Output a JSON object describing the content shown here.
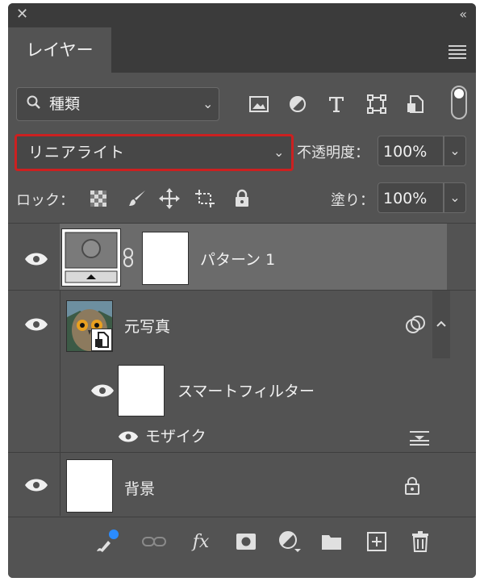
{
  "window": {
    "close_glyph": "✕",
    "collapse_glyph": "‹‹"
  },
  "tab": {
    "label": "レイヤー"
  },
  "filter": {
    "kind_label": "種類",
    "icons": [
      "image-filter-icon",
      "adjustment-filter-icon",
      "type-filter-icon",
      "shape-filter-icon",
      "smart-object-filter-icon"
    ]
  },
  "blend": {
    "mode": "リニアライト"
  },
  "opacity": {
    "label": "不透明度：",
    "value": "100%"
  },
  "lock": {
    "label": "ロック：",
    "icons": [
      "lock-transparent-pixels-icon",
      "lock-image-pixels-icon",
      "lock-position-icon",
      "lock-artboard-icon",
      "lock-all-icon"
    ]
  },
  "fill": {
    "label": "塗り：",
    "value": "100%"
  },
  "layers": [
    {
      "name": "パターン 1",
      "type": "fill-layer",
      "selected": true
    },
    {
      "name": "元写真",
      "type": "smart-object",
      "expanded": true
    },
    {
      "name": "スマートフィルター",
      "type": "smart-filter-mask"
    },
    {
      "name": "モザイク",
      "type": "filter"
    },
    {
      "name": "背景",
      "type": "background",
      "locked": true
    }
  ],
  "colors": {
    "panel": "#535353",
    "selected_row": "#6b6b6b",
    "highlight_border": "#cc2020",
    "badge": "#2b8cff"
  },
  "bottom_icons": [
    "link-layers-icon",
    "fx-icon",
    "add-mask-icon",
    "adjustment-layer-icon",
    "group-folder-icon",
    "new-layer-icon",
    "trash-icon"
  ],
  "bottom": {
    "fx_label": "fx"
  }
}
